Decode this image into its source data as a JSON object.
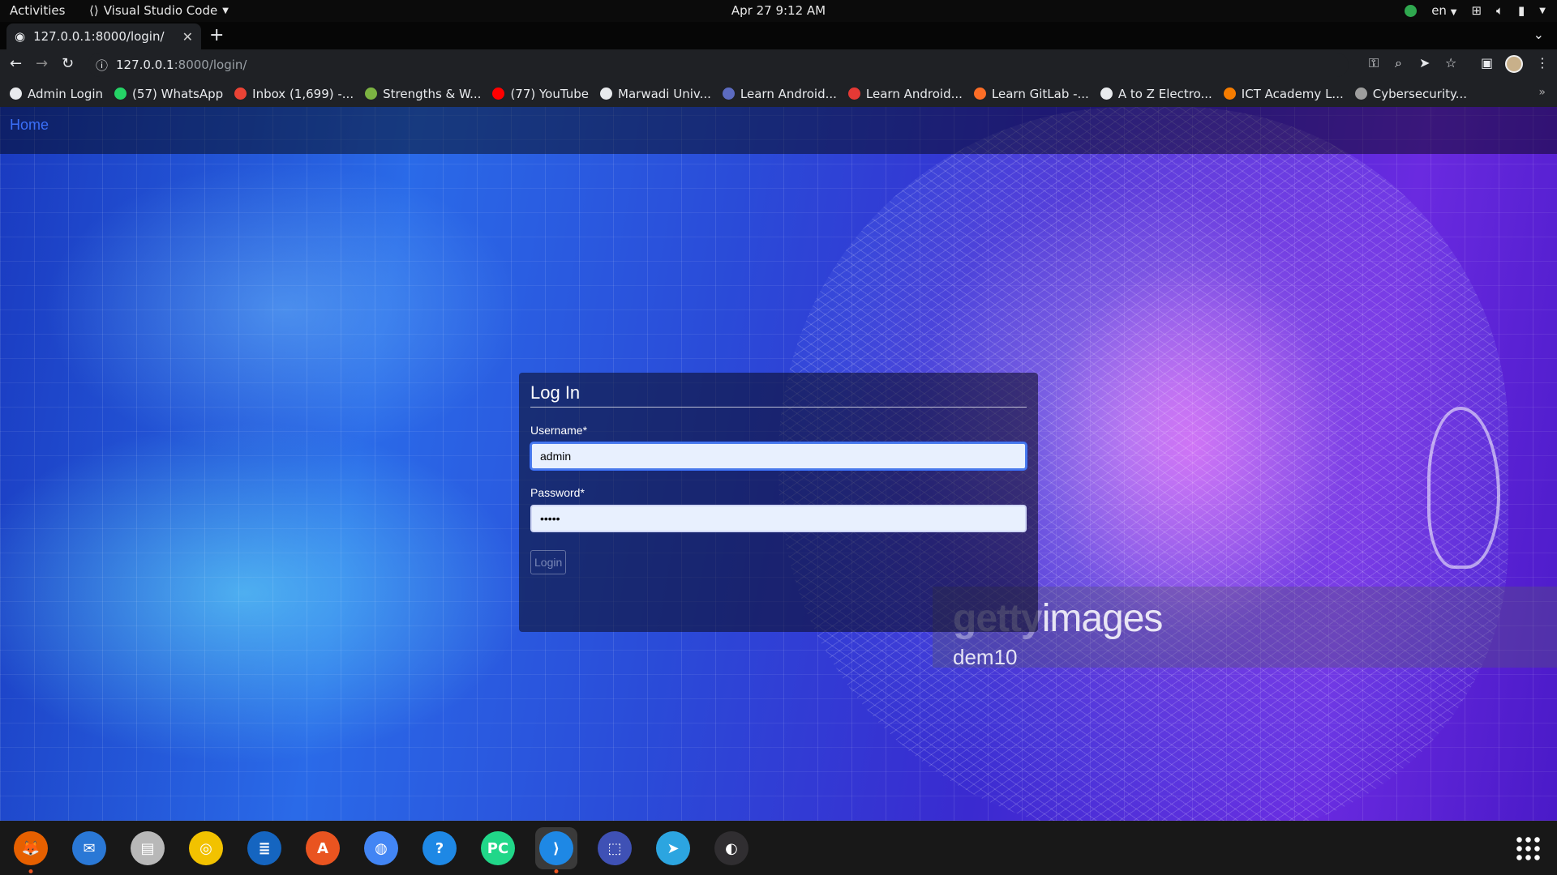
{
  "topbar": {
    "activities": "Activities",
    "app_name": "Visual Studio Code",
    "clock": "Apr 27  9:12 AM",
    "lang": "en"
  },
  "browser": {
    "tab_title": "127.0.0.1:8000/login/",
    "url_host": "127.0.0.1",
    "url_path": ":8000/login/",
    "bookmarks": [
      {
        "label": "Admin Login",
        "icon": "globe-icon",
        "color": "#e8eaed"
      },
      {
        "label": "(57) WhatsApp",
        "icon": "whatsapp-icon",
        "color": "#25d366"
      },
      {
        "label": "Inbox (1,699) -...",
        "icon": "gmail-icon",
        "color": "#ea4335"
      },
      {
        "label": "Strengths & W...",
        "icon": "leaf-icon",
        "color": "#7cb342"
      },
      {
        "label": "(77) YouTube",
        "icon": "youtube-icon",
        "color": "#ff0000"
      },
      {
        "label": "Marwadi Univ...",
        "icon": "globe-icon",
        "color": "#e8eaed"
      },
      {
        "label": "Learn Android...",
        "icon": "grid-icon",
        "color": "#5c6bc0"
      },
      {
        "label": "Learn Android...",
        "icon": "v-icon",
        "color": "#e53935"
      },
      {
        "label": "Learn GitLab -...",
        "icon": "gitlab-icon",
        "color": "#fc6d26"
      },
      {
        "label": "A to Z Electro...",
        "icon": "globe-icon",
        "color": "#e8eaed"
      },
      {
        "label": "ICT Academy L...",
        "icon": "ict-icon",
        "color": "#f57c00"
      },
      {
        "label": "Cybersecurity...",
        "icon": "cloud-icon",
        "color": "#9e9e9e"
      }
    ]
  },
  "page": {
    "nav_home": "Home",
    "login": {
      "title": "Log In",
      "username_label": "Username*",
      "username_value": "admin",
      "password_label": "Password*",
      "password_value": "•••••",
      "button": "Login"
    },
    "watermark": {
      "brand_bold": "getty",
      "brand_light": "images",
      "user": "dem10"
    }
  },
  "dock": {
    "apps": [
      {
        "name": "firefox-icon",
        "color": "#e66000"
      },
      {
        "name": "thunderbird-icon",
        "color": "#2a78d6"
      },
      {
        "name": "files-icon",
        "color": "#b8b8b8"
      },
      {
        "name": "rhythmbox-icon",
        "color": "#f2c200"
      },
      {
        "name": "writer-icon",
        "color": "#1565c0"
      },
      {
        "name": "app-center-icon",
        "color": "#e95420"
      },
      {
        "name": "chrome-icon",
        "color": "#4285f4"
      },
      {
        "name": "help-icon",
        "color": "#1e88e5"
      },
      {
        "name": "pycharm-icon",
        "color": "#21d789"
      },
      {
        "name": "vscode-icon",
        "color": "#1e88e5"
      },
      {
        "name": "screenshot-icon",
        "color": "#3f51b5"
      },
      {
        "name": "telegram-icon",
        "color": "#2ca5e0"
      },
      {
        "name": "obs-icon",
        "color": "#302e31"
      }
    ]
  }
}
